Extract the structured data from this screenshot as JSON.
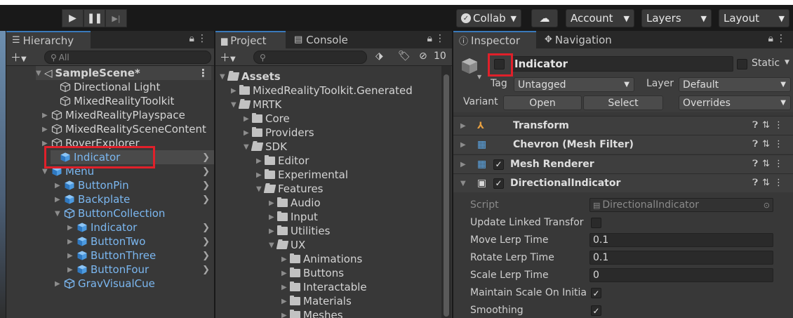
{
  "toolbar": {
    "collab": "Collab",
    "account": "Account",
    "layers": "Layers",
    "layout": "Layout"
  },
  "hierarchy": {
    "tab": "Hierarchy",
    "search_placeholder": "All",
    "scene": "SampleScene*",
    "items": [
      "Directional Light",
      "MixedRealityToolkit",
      "MixedRealityPlayspace",
      "MixedRealitySceneContent",
      "RoverExplorer",
      "Indicator",
      "Menu",
      "ButtonPin",
      "Backplate",
      "ButtonCollection",
      "Indicator",
      "ButtonTwo",
      "ButtonThree",
      "ButtonFour",
      "GravVisualCue"
    ]
  },
  "project": {
    "tab_project": "Project",
    "tab_console": "Console",
    "hidden_count": "10",
    "folders": [
      "Assets",
      "MixedRealityToolkit.Generated",
      "MRTK",
      "Core",
      "Providers",
      "SDK",
      "Editor",
      "Experimental",
      "Features",
      "Audio",
      "Input",
      "Utilities",
      "UX",
      "Animations",
      "Buttons",
      "Interactable",
      "Materials",
      "Meshes"
    ]
  },
  "inspector": {
    "tab_inspector": "Inspector",
    "tab_navigation": "Navigation",
    "object_name": "Indicator",
    "static_label": "Static",
    "tag_label": "Tag",
    "tag_value": "Untagged",
    "layer_label": "Layer",
    "layer_value": "Default",
    "variant_label": "Variant",
    "open_button": "Open",
    "select_button": "Select",
    "overrides": "Overrides",
    "components": [
      "Transform",
      "Chevron (Mesh Filter)",
      "Mesh Renderer",
      "DirectionalIndicator"
    ],
    "props": {
      "script_label": "Script",
      "script_value": "DirectionalIndicator",
      "update_linked": "Update Linked Transfor",
      "move_lerp": "Move Lerp Time",
      "move_lerp_value": "0.1",
      "rotate_lerp": "Rotate Lerp Time",
      "rotate_lerp_value": "0.1",
      "scale_lerp": "Scale Lerp Time",
      "scale_lerp_value": "0",
      "maintain_scale": "Maintain Scale On Initia",
      "smoothing": "Smoothing"
    }
  },
  "colors": {
    "highlight_red": "#e0202a",
    "selection_blue": "#7bb7f0",
    "tab_accent": "#3a79bb"
  }
}
